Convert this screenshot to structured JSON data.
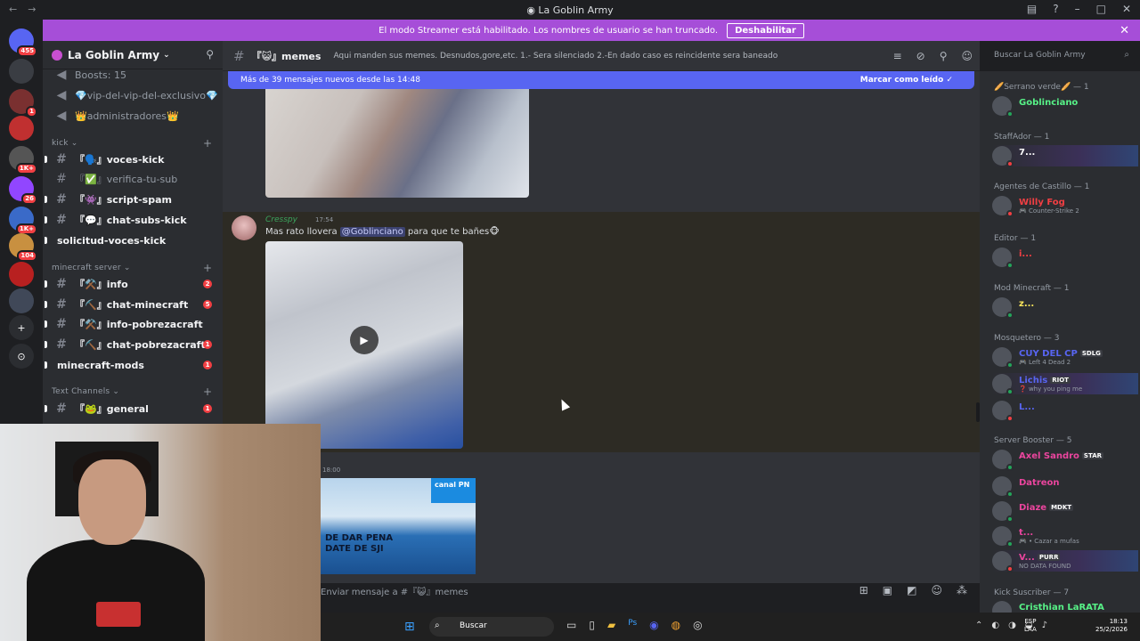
{
  "window": {
    "title": "La Goblin Army"
  },
  "banner": {
    "text": "El modo Streamer está habilitado. Los nombres de usuario se han truncado.",
    "button": "Deshabilitar"
  },
  "servers": [
    {
      "label": "455",
      "color": "#5865f2",
      "badge": "455"
    },
    {
      "label": "",
      "color": "#3a3d43",
      "badge": ""
    },
    {
      "label": "",
      "color": "#7a3030",
      "badge": "1"
    },
    {
      "label": "",
      "color": "#c03030",
      "badge": ""
    },
    {
      "label": "",
      "color": "#555",
      "badge": "1K+"
    },
    {
      "label": "",
      "color": "#9146ff",
      "badge": "26"
    },
    {
      "label": "",
      "color": "#3a6ac8",
      "badge": "1K+"
    },
    {
      "label": "",
      "color": "#c89040",
      "badge": "104"
    },
    {
      "label": "",
      "color": "#b82020",
      "badge": ""
    },
    {
      "label": "",
      "color": "#404858",
      "badge": ""
    }
  ],
  "sidebar": {
    "guild": "La Goblin Army",
    "channels": [
      {
        "name": "Boosts: 15",
        "style": "muted",
        "icon": "🔊",
        "count": ""
      },
      {
        "name": "💎vip-del-vip-del-exclusivo💎",
        "style": "muted",
        "icon": "🔊",
        "count": ""
      },
      {
        "name": "👑administradores👑",
        "style": "muted",
        "icon": "🔊",
        "count": ""
      },
      {
        "name": "『🗣️』voces-kick",
        "style": "bold",
        "icon": "#",
        "count": ""
      },
      {
        "name": "『✅』verifica-tu-sub",
        "style": "muted",
        "icon": "#",
        "count": ""
      },
      {
        "name": "『👾』script-spam",
        "style": "bold",
        "icon": "#",
        "count": ""
      },
      {
        "name": "『💬』chat-subs-kick",
        "style": "bold",
        "icon": "#",
        "count": ""
      },
      {
        "name": "solicitud-voces-kick",
        "style": "bold",
        "icon": "",
        "count": ""
      },
      {
        "name": "『⚒️』info",
        "style": "bold",
        "icon": "#",
        "count": "2"
      },
      {
        "name": "『⛏️』chat-minecraft",
        "style": "bold",
        "icon": "#",
        "count": "5"
      },
      {
        "name": "『⚒️』info-pobrezacraft",
        "style": "bold",
        "icon": "#",
        "count": ""
      },
      {
        "name": "『⛏️』chat-pobrezacraft",
        "style": "bold",
        "icon": "#",
        "count": "1"
      },
      {
        "name": "minecraft-mods",
        "style": "bold",
        "icon": "",
        "count": "1"
      },
      {
        "name": "『🐸』general",
        "style": "bold",
        "icon": "#",
        "count": "1"
      }
    ],
    "categories": [
      "kick",
      "minecraft server",
      "Text Channels"
    ]
  },
  "channel": {
    "name": "『😺』memes",
    "topic": "Aqui manden sus memes. Desnudos,gore,etc. 1.- Sera silenciado 2.-En dado caso es reincidente sera baneado",
    "search_placeholder": "Buscar La Goblin Army"
  },
  "chat": {
    "new_messages": "Más de 39 mensajes nuevos desde las 14:48",
    "mark_read": "Marcar como leído",
    "message": {
      "author": "Cresspy",
      "time": "17:54",
      "text_before": "Mas rato llovera ",
      "mention": "@Goblinciano",
      "text_after": " para que te bañes🐵"
    },
    "next_time": "18:00",
    "image_channel_tag": "canal PN",
    "image_caption": "DE DAR PENA\nDATE DE SJI",
    "composer_placeholder": "Enviar mensaje a #『😺』memes"
  },
  "members": {
    "groups": [
      {
        "role": "🥖Serrano verde🥖 — 1",
        "members": [
          {
            "name": "Goblinciano",
            "color": "#57f287",
            "sub": "",
            "tag": "",
            "status": "online",
            "hl": false
          }
        ]
      },
      {
        "role": "StaffAdor — 1",
        "members": [
          {
            "name": "7...",
            "color": "#ffffff",
            "sub": "",
            "tag": "",
            "status": "dnd",
            "hl": true
          }
        ]
      },
      {
        "role": "Agentes de Castillo — 1",
        "members": [
          {
            "name": "Willy Fog",
            "color": "#f23f43",
            "sub": "🎮 Counter-Strike 2",
            "tag": "",
            "status": "dnd",
            "hl": false
          }
        ]
      },
      {
        "role": "Editor — 1",
        "members": [
          {
            "name": "i...",
            "color": "#f23f43",
            "sub": "",
            "tag": "",
            "status": "online",
            "hl": false
          }
        ]
      },
      {
        "role": "Mod Minecraft — 1",
        "members": [
          {
            "name": "z...",
            "color": "#fee75c",
            "sub": "",
            "tag": "",
            "status": "online",
            "hl": false
          }
        ]
      },
      {
        "role": "Mosquetero — 3",
        "members": [
          {
            "name": "CUY DEL CP",
            "color": "#5865f2",
            "sub": "🎮 Left 4 Dead 2",
            "tag": "SDLG",
            "status": "online",
            "hl": false
          },
          {
            "name": "Lichis",
            "color": "#5865f2",
            "sub": "❓ why you ping me",
            "tag": "RIOT",
            "status": "online",
            "hl": true
          },
          {
            "name": "L...",
            "color": "#5865f2",
            "sub": "",
            "tag": "",
            "status": "dnd",
            "hl": false
          }
        ]
      },
      {
        "role": "Server Booster — 5",
        "members": [
          {
            "name": "Axel Sandro",
            "color": "#eb459e",
            "sub": "",
            "tag": "STAR",
            "status": "online",
            "hl": false
          },
          {
            "name": "Datreon",
            "color": "#eb459e",
            "sub": "",
            "tag": "",
            "status": "online",
            "hl": false
          },
          {
            "name": "Diaze",
            "color": "#eb459e",
            "sub": "",
            "tag": "MDKT",
            "status": "online",
            "hl": false
          },
          {
            "name": "t...",
            "color": "#eb459e",
            "sub": "🎮 • Cazar a mufas",
            "tag": "",
            "status": "online",
            "hl": false
          },
          {
            "name": "V...",
            "color": "#eb459e",
            "sub": "NO DATA FOUND",
            "tag": "PURR",
            "status": "dnd",
            "hl": true
          }
        ]
      },
      {
        "role": "Kick Suscriber — 7",
        "members": [
          {
            "name": "Cristhian LaRATA",
            "color": "#57f287",
            "sub": "",
            "tag": "",
            "status": "online",
            "hl": false
          }
        ]
      }
    ]
  },
  "taskbar": {
    "search": "Buscar",
    "lang": "ESP\nLAA",
    "time": "18:13",
    "date": "25/2/2026"
  }
}
